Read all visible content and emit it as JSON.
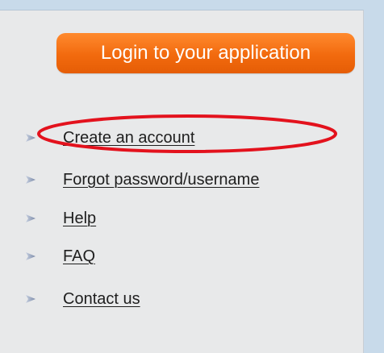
{
  "login_button": {
    "label": "Login to your application"
  },
  "links": [
    {
      "label": "Create an account"
    },
    {
      "label": "Forgot password/username"
    },
    {
      "label": "Help"
    },
    {
      "label": "FAQ"
    },
    {
      "label": "Contact us"
    }
  ],
  "colors": {
    "page_background": "#c8daea",
    "panel_background": "#e8e9ea",
    "button_orange": "#f26a0e",
    "button_text": "#ffffff",
    "link_text": "#1e1e1e",
    "annotation_red": "#e3121d"
  },
  "icons": {
    "bullet": "arrow-bullet-icon"
  }
}
